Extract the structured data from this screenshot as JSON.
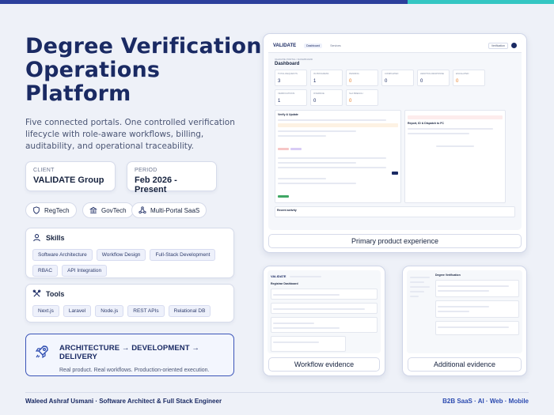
{
  "header": {
    "title": "Degree Verification Operations Platform",
    "subtitle": "Five connected portals. One controlled verification lifecycle with role-aware workflows, billing, auditability, and operational traceability."
  },
  "meta": {
    "client_label": "CLIENT",
    "client_value": "VALIDATE Group",
    "period_label": "PERIOD",
    "period_value": "Feb 2026 - Present"
  },
  "pills": [
    {
      "label": "RegTech",
      "icon": "shield-icon"
    },
    {
      "label": "GovTech",
      "icon": "bank-icon"
    },
    {
      "label": "Multi-Portal SaaS",
      "icon": "network-icon"
    }
  ],
  "skills": {
    "title": "Skills",
    "items": [
      "Software Architecture",
      "Workflow Design",
      "Full-Stack Development",
      "RBAC",
      "API Integration"
    ]
  },
  "tools": {
    "title": "Tools",
    "items": [
      "Next.js",
      "Laravel",
      "Node.js",
      "REST APIs",
      "Relational DB"
    ]
  },
  "architecture": {
    "title": "ARCHITECTURE → DEVELOPMENT → DELIVERY",
    "subtitle": "Real product. Real workflows. Production-oriented execution."
  },
  "screens": {
    "primary_caption": "Primary product experience",
    "workflow_caption": "Workflow evidence",
    "additional_caption": "Additional evidence",
    "primary": {
      "logo": "VALIDATE",
      "nav": [
        "Dashboard",
        "Services"
      ],
      "nav_button": "Verification",
      "crumb": "VALIDATE PORTAL / DASHBOARD",
      "title": "Dashboard",
      "stats_row1": [
        {
          "label": "TOTAL REQUESTS",
          "value": "3"
        },
        {
          "label": "IN PROGRESS",
          "value": "1"
        },
        {
          "label": "PENDING",
          "value": "0"
        },
        {
          "label": "COMPLETED",
          "value": "0"
        },
        {
          "label": "AWAITING RESPONSE",
          "value": "0"
        },
        {
          "label": "ESCALATED",
          "value": "0"
        }
      ],
      "stats_row2": [
        {
          "label": "VERIFICATIONS",
          "value": "1"
        },
        {
          "label": "OVERDUE",
          "value": "0"
        },
        {
          "label": "SLA BREACH",
          "value": "0"
        }
      ],
      "pane_left": "Verify & Update",
      "pane_right": "Report, ID & Dispatch to FC",
      "bottom": "Recent activity"
    },
    "workflow": {
      "logo": "VALIDATE",
      "title": "Registrar Dashboard"
    },
    "additional": {
      "title": "Degree Verification"
    }
  },
  "footer": {
    "left": "Waleed Ashraf Usmani · Software Architect & Full Stack Engineer",
    "right": "B2B SaaS · AI · Web · Mobile"
  },
  "colors": {
    "primary": "#1a2a63",
    "accent": "#2c4bb0",
    "teal": "#34c6c3",
    "background": "#eef1f8"
  }
}
